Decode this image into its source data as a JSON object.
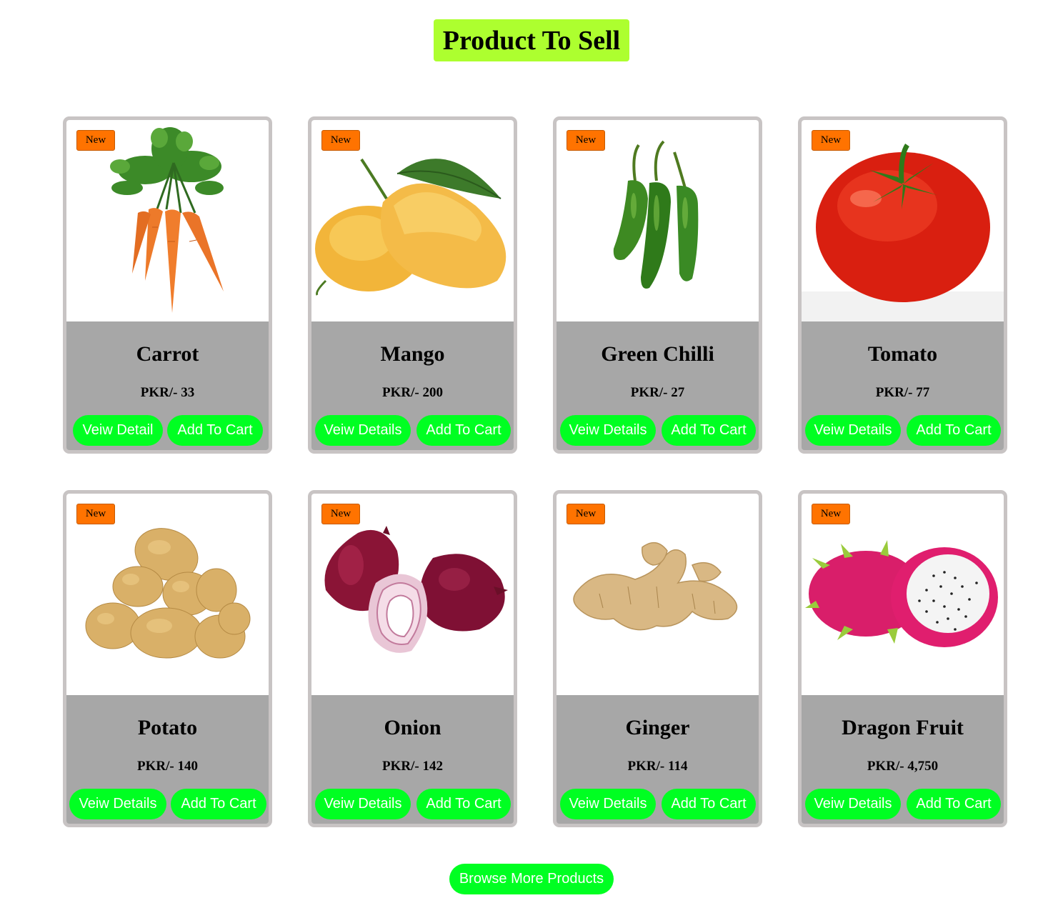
{
  "heading": "Product To Sell",
  "products": [
    {
      "badge": "New",
      "name": "Carrot",
      "price": "PKR/- 33",
      "details_label": "Veiw Detail",
      "cart_label": "Add To Cart",
      "image": "carrot"
    },
    {
      "badge": "New",
      "name": "Mango",
      "price": "PKR/- 200",
      "details_label": "Veiw Details",
      "cart_label": "Add To Cart",
      "image": "mango"
    },
    {
      "badge": "New",
      "name": "Green Chilli",
      "price": "PKR/- 27",
      "details_label": "Veiw Details",
      "cart_label": "Add To Cart",
      "image": "green-chilli"
    },
    {
      "badge": "New",
      "name": "Tomato",
      "price": "PKR/- 77",
      "details_label": "Veiw Details",
      "cart_label": "Add To Cart",
      "image": "tomato"
    },
    {
      "badge": "New",
      "name": "Potato",
      "price": "PKR/- 140",
      "details_label": "Veiw Details",
      "cart_label": "Add To Cart",
      "image": "potato"
    },
    {
      "badge": "New",
      "name": "Onion",
      "price": "PKR/- 142",
      "details_label": "Veiw Details",
      "cart_label": "Add To Cart",
      "image": "onion"
    },
    {
      "badge": "New",
      "name": "Ginger",
      "price": "PKR/- 114",
      "details_label": "Veiw Details",
      "cart_label": "Add To Cart",
      "image": "ginger"
    },
    {
      "badge": "New",
      "name": "Dragon Fruit",
      "price": "PKR/- 4,750",
      "details_label": "Veiw Details",
      "cart_label": "Add To Cart",
      "image": "dragon-fruit"
    }
  ],
  "browse_label": "Browse More Products",
  "colors": {
    "heading_bg": "#adff2f",
    "badge_bg": "#ff7300",
    "button_bg": "#00ff22",
    "card_border": "#c8c4c4",
    "card_body": "#a7a7a7"
  }
}
